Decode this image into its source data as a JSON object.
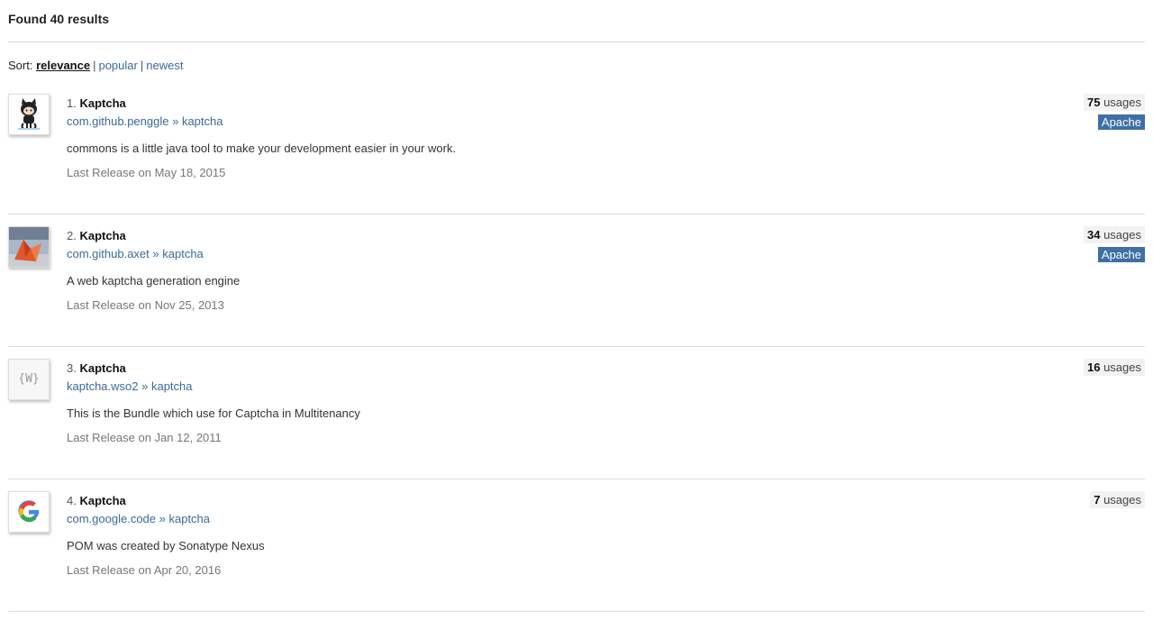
{
  "header": {
    "found_text": "Found 40 results"
  },
  "sort": {
    "label": "Sort: ",
    "options": [
      {
        "label": "relevance",
        "active": true
      },
      {
        "label": "popular",
        "active": false
      },
      {
        "label": "newest",
        "active": false
      }
    ]
  },
  "results": [
    {
      "index": "1.",
      "name": "Kaptcha",
      "group": "com.github.penggle",
      "sep": " » ",
      "artifact": "kaptcha",
      "description": "commons is a little java tool to make your development easier in your work.",
      "release": "Last Release on May 18, 2015",
      "usages_count": "75",
      "usages_label": "usages",
      "license": "Apache",
      "logo": "github-octocat-icon"
    },
    {
      "index": "2.",
      "name": "Kaptcha",
      "group": "com.github.axet",
      "sep": " » ",
      "artifact": "kaptcha",
      "description": "A web kaptcha generation engine",
      "release": "Last Release on Nov 25, 2013",
      "usages_count": "34",
      "usages_label": "usages",
      "license": "Apache",
      "logo": "origami-fox-photo-icon"
    },
    {
      "index": "3.",
      "name": "Kaptcha",
      "group": "kaptcha.wso2",
      "sep": " » ",
      "artifact": "kaptcha",
      "description": "This is the Bundle which use for Captcha in Multitenancy",
      "release": "Last Release on Jan 12, 2011",
      "usages_count": "16",
      "usages_label": "usages",
      "license": "",
      "logo": "generic-w-braces-icon",
      "logo_text": "{W}"
    },
    {
      "index": "4.",
      "name": "Kaptcha",
      "group": "com.google.code",
      "sep": " » ",
      "artifact": "kaptcha",
      "description": "POM was created by Sonatype Nexus",
      "release": "Last Release on Apr 20, 2016",
      "usages_count": "7",
      "usages_label": "usages",
      "license": "",
      "logo": "google-g-icon"
    }
  ]
}
